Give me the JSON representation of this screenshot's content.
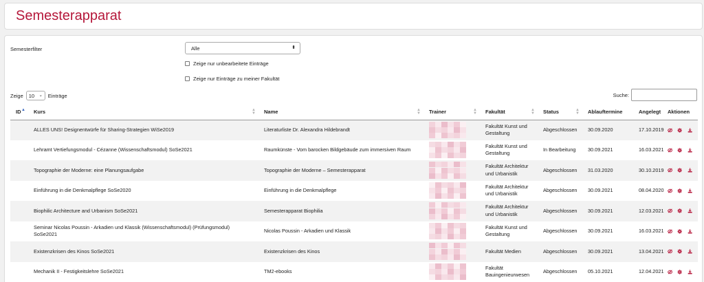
{
  "header": {
    "title": "Semesterapparat"
  },
  "filter": {
    "label": "Semesterfilter",
    "selected": "Alle",
    "checkbox1": "Zeige nur unbearbeitete Einträge",
    "checkbox2": "Zeige nur Einträge zu meiner Fakultät"
  },
  "length": {
    "prefix": "Zeige",
    "value": "10",
    "suffix": "Einträge"
  },
  "search": {
    "label": "Suche:"
  },
  "columns": {
    "id": "ID",
    "kurs": "Kurs",
    "name": "Name",
    "trainer": "Trainer",
    "fakultaet": "Fakultät",
    "status": "Status",
    "ablauf": "Ablauftermine",
    "angelegt": "Angelegt",
    "aktionen": "Aktionen"
  },
  "colors": {
    "accent": "#b5173a"
  },
  "icons": {
    "view": "eye-slash-icon",
    "settings": "gear-icon",
    "download": "download-icon"
  },
  "rows": [
    {
      "kurs": "ALLES UNS! Designentwürfe für Sharing-Strategien WiSe2019",
      "name": "Literaturliste Dr. Alexandra Hildebrandt",
      "fakultaet": "Fakultät Kunst und Gestaltung",
      "status": "Abgeschlossen",
      "ablauf": "30.09.2020",
      "angelegt": "17.10.2019"
    },
    {
      "kurs": "Lehramt Vertiefungsmodul - Cézanne (Wissenschaftsmodul) SoSe2021",
      "name": "Raumkünste - Vom barocken Bildgebäude zum immersiven Raum",
      "fakultaet": "Fakultät Kunst und Gestaltung",
      "status": "In Bearbeitung",
      "ablauf": "30.09.2021",
      "angelegt": "16.03.2021"
    },
    {
      "kurs": "Topographie der Moderne: eine Planungsaufgabe",
      "name": "Topographie der Moderne – Semesterapparat",
      "fakultaet": "Fakultät Architektur und Urbanistik",
      "status": "Abgeschlossen",
      "ablauf": "31.03.2020",
      "angelegt": "30.10.2019"
    },
    {
      "kurs": "Einführung in die Denkmalpflege SoSe2020",
      "name": "Einführung in die Denkmalpflege",
      "fakultaet": "Fakultät Architektur und Urbanistik",
      "status": "Abgeschlossen",
      "ablauf": "30.09.2021",
      "angelegt": "08.04.2020"
    },
    {
      "kurs": "Biophilic Architecture and Urbanism SoSe2021",
      "name": "Semesterapparat Biophilia",
      "fakultaet": "Fakultät Architektur und Urbanistik",
      "status": "Abgeschlossen",
      "ablauf": "30.09.2021",
      "angelegt": "12.03.2021"
    },
    {
      "kurs": "Seminar Nicolas Poussin - Arkadien und Klassik (Wissenschaftsmodul) (Prüfungsmodul) SoSe2021",
      "name": "Nicolas Poussin - Arkadien und Klassik",
      "fakultaet": "Fakultät Kunst und Gestaltung",
      "status": "Abgeschlossen",
      "ablauf": "30.09.2021",
      "angelegt": "16.03.2021"
    },
    {
      "kurs": "Existenzkrisen des Kinos SoSe2021",
      "name": "Existenzkrisen des Kinos",
      "fakultaet": "Fakultät Medien",
      "status": "Abgeschlossen",
      "ablauf": "30.09.2021",
      "angelegt": "13.04.2021"
    },
    {
      "kurs": "Mechanik II - Festigkeitslehre SoSe2021",
      "name": "TM2-ebooks",
      "fakultaet": "Fakultät Bauingenieurwesen",
      "status": "Abgeschlossen",
      "ablauf": "05.10.2021",
      "angelegt": "12.04.2021"
    }
  ]
}
